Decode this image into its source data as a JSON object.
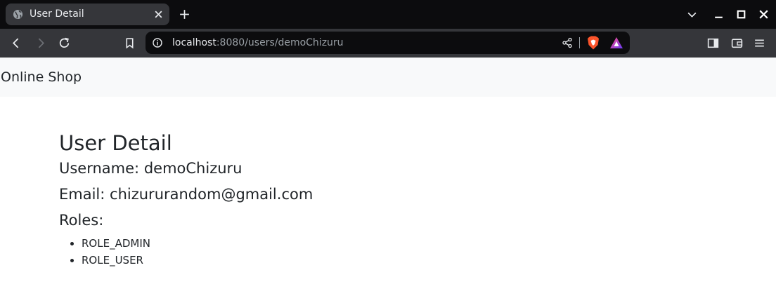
{
  "browser": {
    "tab": {
      "title": "User Detail",
      "icon": "globe-icon"
    },
    "address_bar": {
      "host": "localhost",
      "path": ":8080/users/demoChizuru"
    }
  },
  "page": {
    "brand": "Online Shop",
    "title": "User Detail",
    "username": {
      "label": "Username:",
      "value": "demoChizuru"
    },
    "email": {
      "label": "Email:",
      "value": "chizururandom@gmail.com"
    },
    "roles": {
      "label": "Roles:",
      "items": [
        "ROLE_ADMIN",
        "ROLE_USER"
      ]
    }
  },
  "colors": {
    "chrome_bg": "#0c0c0e",
    "toolbar_bg": "#35363a",
    "navbar_bg": "#f8f9fa",
    "text": "#212529"
  }
}
